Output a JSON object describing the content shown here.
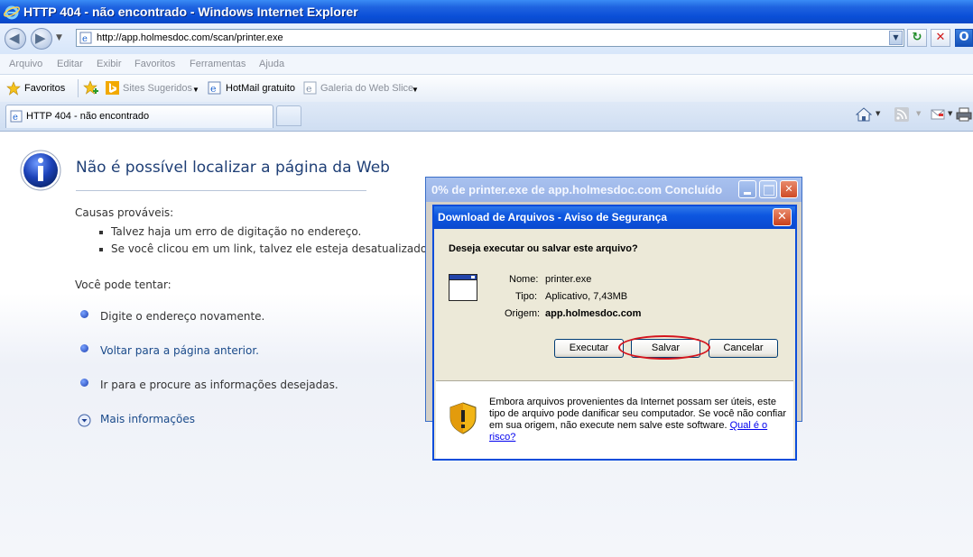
{
  "window": {
    "title": "HTTP 404 - não encontrado - Windows Internet Explorer"
  },
  "address": {
    "url": "http://app.holmesdoc.com/scan/printer.exe"
  },
  "menu": [
    "Arquivo",
    "Editar",
    "Exibir",
    "Favoritos",
    "Ferramentas",
    "Ajuda"
  ],
  "favorites": {
    "label": "Favoritos",
    "items": [
      "Sites Sugeridos",
      "HotMail gratuito",
      "Galeria do Web Slice"
    ]
  },
  "tab": {
    "label": "HTTP 404 - não encontrado"
  },
  "page": {
    "title": "Não é possível localizar a página da Web",
    "causes_heading": "Causas prováveis:",
    "causes": [
      "Talvez haja um erro de digitação no endereço.",
      "Se você clicou em um link, talvez ele esteja desatualizado."
    ],
    "try_heading": "Você pode tentar:",
    "try_items": [
      "Digite o endereço novamente.",
      "Voltar para a página anterior.",
      "Ir para  e procure as informações desejadas."
    ],
    "more_info": "Mais informações"
  },
  "download_window": {
    "title": "0% de printer.exe de app.holmesdoc.com Concluído"
  },
  "security_dialog": {
    "title": "Download de Arquivos - Aviso de Segurança",
    "question": "Deseja executar ou salvar este arquivo?",
    "name_label": "Nome:",
    "name_value": "printer.exe",
    "type_label": "Tipo:",
    "type_value": "Aplicativo, 7,43MB",
    "origin_label": "Origem:",
    "origin_value": "app.holmesdoc.com",
    "buttons": {
      "run": "Executar",
      "save": "Salvar",
      "cancel": "Cancelar"
    },
    "warning_lines": [
      "Embora arquivos provenientes da Internet possam ser úteis, este",
      "tipo de arquivo pode danificar seu computador. Se você não confiar",
      "em sua origem, não execute nem salve este software. "
    ],
    "risk_link_1": "Qual é o",
    "risk_link_2": "risco?"
  },
  "colors": {
    "titlebar": "#0a4fd8",
    "dialog_title": "#0d56e0",
    "highlight": "#d4141d",
    "page_title": "#1f3f76"
  }
}
